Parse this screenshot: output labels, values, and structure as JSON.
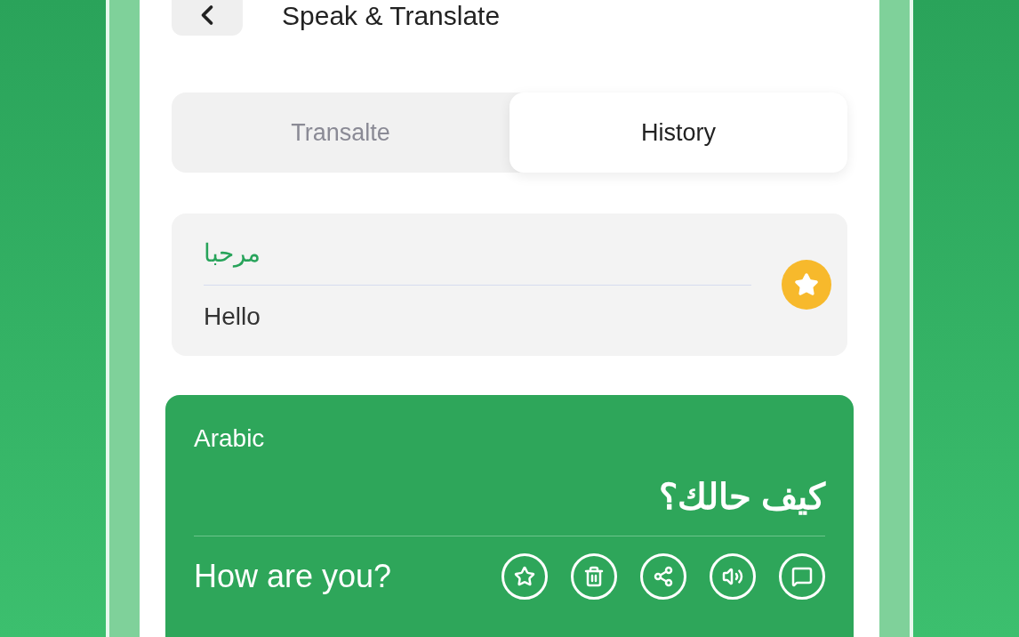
{
  "header": {
    "title": "Speak & Translate"
  },
  "tabs": [
    {
      "label": "Transalte",
      "selected": false
    },
    {
      "label": "History",
      "selected": true
    }
  ],
  "history_item": {
    "source": "مرحبا",
    "translation": "Hello",
    "favorite": true
  },
  "result_card": {
    "language": "Arabic",
    "source": "كيف حالك؟",
    "translation": "How are you?"
  }
}
